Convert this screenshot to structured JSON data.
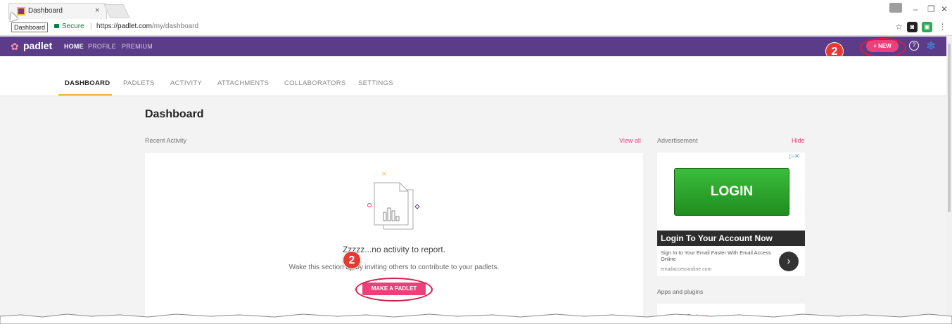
{
  "browser": {
    "tab_title": "Dashboard",
    "tab_close": "×",
    "tooltip": "Dashboard",
    "secure_label": "Secure",
    "separator": "|",
    "url_scheme": "https://",
    "url_host": "padlet.com",
    "url_path": "/my/dashboard",
    "window_controls": [
      "–",
      "❐",
      "✕"
    ]
  },
  "navbar": {
    "logo": "padlet",
    "items": [
      "HOME",
      "PROFILE",
      "PREMIUM"
    ],
    "active_item": "HOME",
    "new_button": "+ NEW",
    "help": "?"
  },
  "annotations": {
    "badge_top": "2",
    "badge_bottom": "2"
  },
  "subtabs": [
    "DASHBOARD",
    "PADLETS",
    "ACTIVITY",
    "ATTACHMENTS",
    "COLLABORATORS",
    "SETTINGS"
  ],
  "main": {
    "title": "Dashboard",
    "recent_activity_label": "Recent Activity",
    "view_all": "View all",
    "empty_title": "Zzzzz...no activity to report.",
    "empty_sub": "Wake this section up by inviting others to contribute to your padlets.",
    "make_button": "MAKE A PADLET"
  },
  "sidebar": {
    "advertisement_label": "Advertisement",
    "hide": "Hide",
    "ad_corner": "▷✕",
    "ad_button": "LOGIN",
    "ad_headline": "Login To Your Account Now",
    "ad_desc": "Sign In to Your Email Faster With Email Access Online",
    "ad_domain": "emailaccessonline.com",
    "ad_arrow": "›",
    "apps_label": "Apps and plugins",
    "app_name": "iPad app"
  },
  "colors": {
    "brand_purple": "#5b3c88",
    "accent_pink": "#ef3f7a",
    "annotation_red": "#e53935"
  }
}
